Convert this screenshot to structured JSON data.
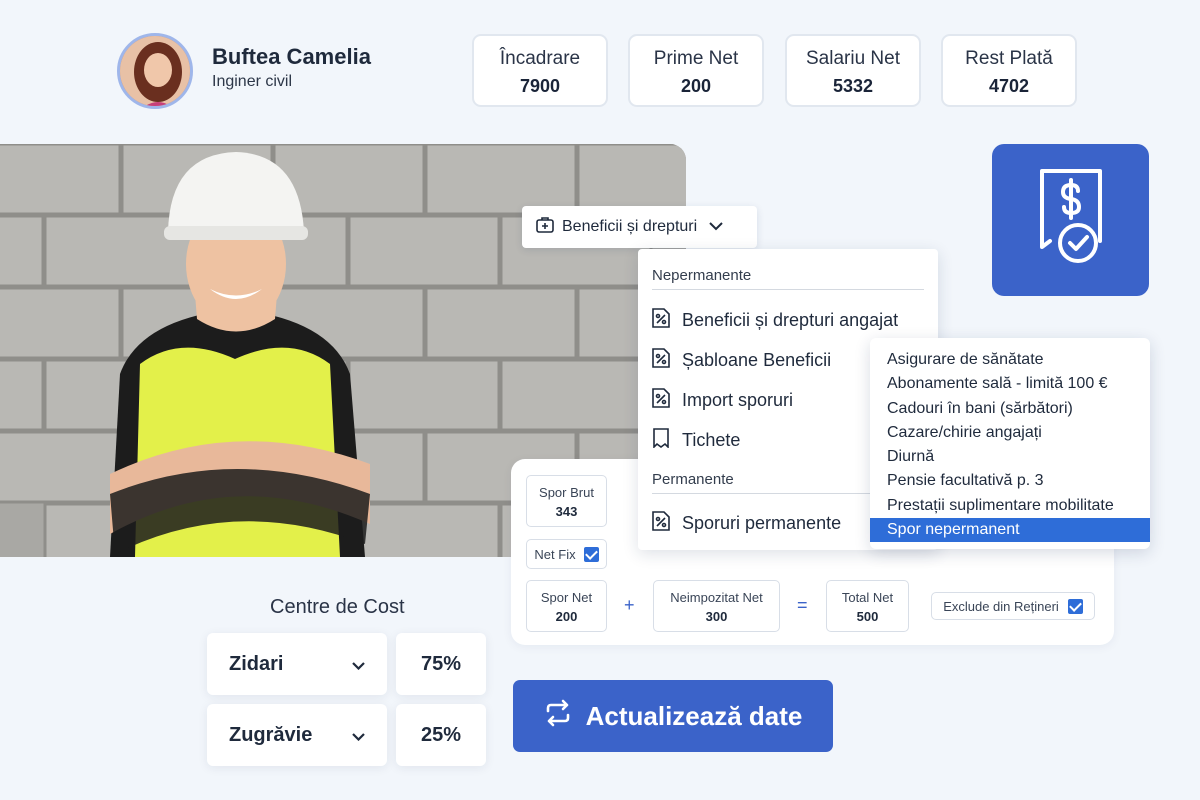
{
  "profile": {
    "name": "Buftea Camelia",
    "role": "Inginer civil"
  },
  "stats": [
    {
      "label": "Încadrare",
      "value": "7900"
    },
    {
      "label": "Prime Net",
      "value": "200"
    },
    {
      "label": "Salariu Net",
      "value": "5332"
    },
    {
      "label": "Rest Plată",
      "value": "4702"
    }
  ],
  "dropdown": {
    "label": "Beneficii și drepturi"
  },
  "menu": {
    "section_nonpermanent": "Nepermanente",
    "items": [
      {
        "label": "Beneficii și drepturi angajat",
        "icon": "percent-tag-icon"
      },
      {
        "label": "Șabloane Beneficii",
        "icon": "percent-tag-icon"
      },
      {
        "label": "Import sporuri",
        "icon": "percent-tag-icon"
      },
      {
        "label": "Tichete",
        "icon": "ticket-icon"
      }
    ],
    "section_permanent": "Permanente",
    "permanent_item": {
      "label": "Sporuri permanente",
      "icon": "percent-tag-icon"
    }
  },
  "submenu": {
    "items": [
      "Asigurare de sănătate",
      "Abonamente sală - limită 100 €",
      "Cadouri în bani (sărbători)",
      "Cazare/chirie angajați",
      "Diurnă",
      "Pensie facultativă p. 3",
      "Prestații suplimentare mobilitate",
      "Spor nepermanent"
    ],
    "selected": "Spor nepermanent"
  },
  "calc": {
    "spor_brut": {
      "label": "Spor Brut",
      "value": "343"
    },
    "net_fix": {
      "label": "Net Fix",
      "checked": true
    },
    "spor_net": {
      "label": "Spor Net",
      "value": "200"
    },
    "plus": "+",
    "neimpozitat": {
      "label": "Neimpozitat Net",
      "value": "300"
    },
    "equals": "=",
    "total_net": {
      "label": "Total Net",
      "value": "500"
    },
    "exclude": {
      "label": "Exclude din Rețineri",
      "checked": true
    }
  },
  "cost_centers": {
    "title": "Centre de Cost",
    "rows": [
      {
        "name": "Zidari",
        "percent": "75%"
      },
      {
        "name": "Zugrăvie",
        "percent": "25%"
      }
    ]
  },
  "update_button": {
    "label": "Actualizează date"
  },
  "colors": {
    "accent": "#3b63c9",
    "selected": "#2e6dd8",
    "background": "#f2f6fb"
  }
}
